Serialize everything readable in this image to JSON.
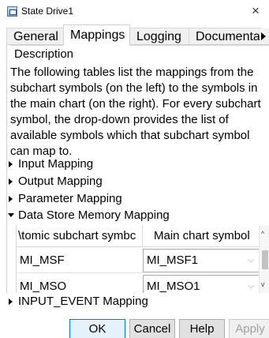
{
  "window": {
    "title": "State Drive1",
    "close_glyph": "×"
  },
  "tabs": [
    {
      "label": "General"
    },
    {
      "label": "Mappings",
      "active": true
    },
    {
      "label": "Logging"
    },
    {
      "label": "Documentati"
    }
  ],
  "description": {
    "label": "Description",
    "text": "The following tables list the mappings from the subchart symbols (on the left) to the symbols in the main chart (on the right). For every subchart symbol, the drop-down provides the list of available symbols which that subchart symbol can map to."
  },
  "sections": [
    {
      "label": "Input Mapping",
      "expanded": false
    },
    {
      "label": "Output Mapping",
      "expanded": false
    },
    {
      "label": "Parameter Mapping",
      "expanded": false
    },
    {
      "label": "Data Store Memory Mapping",
      "expanded": true
    },
    {
      "label": "INPUT_EVENT Mapping",
      "expanded": false
    }
  ],
  "mapping_table": {
    "headers": [
      "\\tomic subchart symbc",
      "Main chart symbol"
    ],
    "rows": [
      {
        "subchart": "MI_MSF",
        "main": "MI_MSF1"
      },
      {
        "subchart": "MI_MSO",
        "main": "MI_MSO1"
      }
    ]
  },
  "buttons": {
    "ok": "OK",
    "cancel": "Cancel",
    "help": "Help",
    "apply": "Apply"
  },
  "colors": {
    "default_button_border": "#0078d7",
    "disabled_text": "#a0a0a0"
  },
  "icons": {
    "app": "stateflow-window-icon",
    "tab_scroll": "triangle-right-icon"
  }
}
